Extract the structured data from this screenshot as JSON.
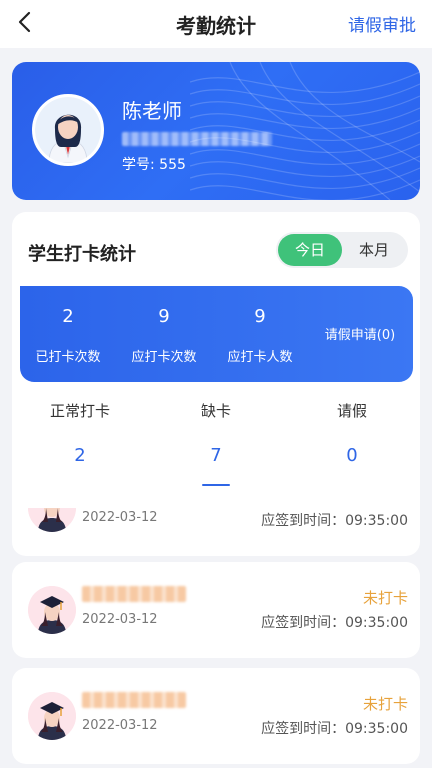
{
  "header": {
    "title": "考勤统计",
    "right_action": "请假审批",
    "back_icon": "chevron-left-icon"
  },
  "profile": {
    "name": "陈老师",
    "student_no": "学号: 555"
  },
  "stats": {
    "title": "学生打卡统计",
    "toggle": {
      "today": "今日",
      "month": "本月",
      "selected": "今日"
    },
    "summary": [
      {
        "value": "2",
        "label": "已打卡次数"
      },
      {
        "value": "9",
        "label": "应打卡次数"
      },
      {
        "value": "9",
        "label": "应打卡人数"
      }
    ],
    "leave_apply": "请假申请(0)",
    "categories": [
      {
        "label": "正常打卡",
        "count": "2"
      },
      {
        "label": "缺卡",
        "count": "7"
      },
      {
        "label": "请假",
        "count": "0"
      }
    ],
    "selected_category": "缺卡"
  },
  "records": [
    {
      "date": "2022-03-12",
      "status": "",
      "time": "应签到时间：09:35:00"
    },
    {
      "date": "2022-03-12",
      "status": "未打卡",
      "time": "应签到时间：09:35:00"
    },
    {
      "date": "2022-03-12",
      "status": "未打卡",
      "time": "应签到时间：09:35:00"
    }
  ],
  "colors": {
    "accent": "#2f66e6",
    "toggle_active": "#3fc27a",
    "warning": "#e7a23b"
  }
}
